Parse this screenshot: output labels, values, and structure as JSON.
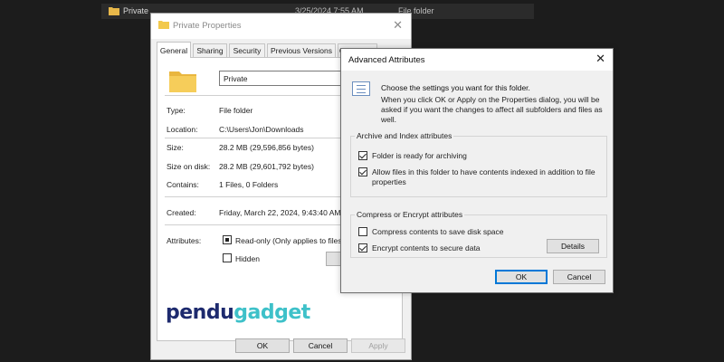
{
  "explorer": {
    "name": "Private",
    "date": "3/25/2024 7:55 AM",
    "type": "File folder"
  },
  "properties": {
    "title": "Private Properties",
    "close_glyph": "✕",
    "tabs": [
      "General",
      "Sharing",
      "Security",
      "Previous Versions",
      "Customize"
    ],
    "folder_name": "Private",
    "fields": {
      "type_label": "Type:",
      "type_value": "File folder",
      "location_label": "Location:",
      "location_value": "C:\\Users\\Jon\\Downloads",
      "size_label": "Size:",
      "size_value": "28.2 MB (29,596,856 bytes)",
      "size_on_disk_label": "Size on disk:",
      "size_on_disk_value": "28.2 MB (29,601,792 bytes)",
      "contains_label": "Contains:",
      "contains_value": "1 Files, 0 Folders",
      "created_label": "Created:",
      "created_value": "Friday, March 22, 2024, 9:43:40 AM",
      "attributes_label": "Attributes:"
    },
    "readonly_label": "Read-only (Only applies to files in folder)",
    "hidden_label": "Hidden",
    "advanced_button": "Advanced...",
    "ok": "OK",
    "cancel": "Cancel",
    "apply": "Apply"
  },
  "advanced": {
    "title": "Advanced Attributes",
    "close_glyph": "✕",
    "intro": "Choose the settings you want for this folder.",
    "note": "When you click OK or Apply on the Properties dialog, you will be asked if you want the changes to affect all subfolders and files as well.",
    "archive_group": "Archive and Index attributes",
    "archive_ready": "Folder is ready for archiving",
    "index_allow": "Allow files in this folder to have contents indexed in addition to file properties",
    "compress_group": "Compress or Encrypt attributes",
    "compress": "Compress contents to save disk space",
    "encrypt": "Encrypt contents to secure data",
    "details": "Details",
    "ok": "OK",
    "cancel": "Cancel",
    "states": {
      "archive_ready": true,
      "index_allow": true,
      "compress": false,
      "encrypt": true
    }
  },
  "logo": {
    "text_main": "pendu",
    "text_accent": "gadget"
  },
  "colors": {
    "folder": "#f2c94c",
    "accent": "#0078d7",
    "logo_main": "#1d2a6e",
    "logo_accent": "#3ec1c9"
  }
}
